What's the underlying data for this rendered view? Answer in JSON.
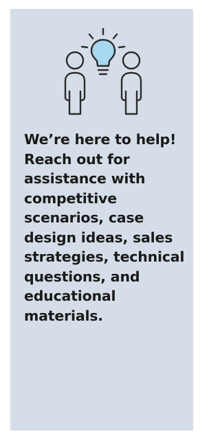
{
  "card": {
    "icon": "two-people-with-lightbulb-icon",
    "background_color": "#d5dee8",
    "icon_stroke_color": "#2b2b2b",
    "bulb_color": "#a8d8f0",
    "message": "We’re here to help! Reach out for assistance with competitive scenarios, case design ideas, sales strategies, technical questions, and educational materials."
  }
}
